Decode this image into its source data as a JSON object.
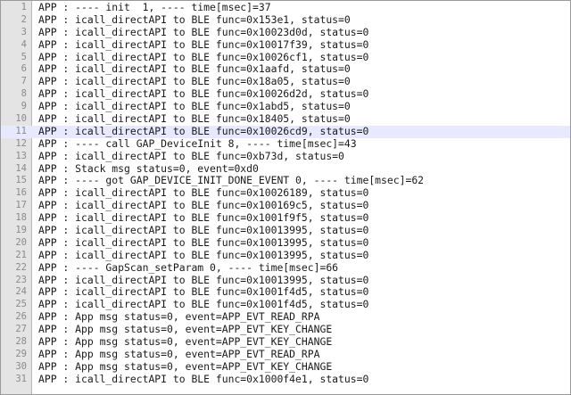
{
  "editor": {
    "active_line": 11,
    "lines": [
      {
        "number": "1",
        "text": "APP : ---- init  1, ---- time[msec]=37"
      },
      {
        "number": "2",
        "text": "APP : icall_directAPI to BLE func=0x153e1, status=0"
      },
      {
        "number": "3",
        "text": "APP : icall_directAPI to BLE func=0x10023d0d, status=0"
      },
      {
        "number": "4",
        "text": "APP : icall_directAPI to BLE func=0x10017f39, status=0"
      },
      {
        "number": "5",
        "text": "APP : icall_directAPI to BLE func=0x10026cf1, status=0"
      },
      {
        "number": "6",
        "text": "APP : icall_directAPI to BLE func=0x1aafd, status=0"
      },
      {
        "number": "7",
        "text": "APP : icall_directAPI to BLE func=0x18a05, status=0"
      },
      {
        "number": "8",
        "text": "APP : icall_directAPI to BLE func=0x10026d2d, status=0"
      },
      {
        "number": "9",
        "text": "APP : icall_directAPI to BLE func=0x1abd5, status=0"
      },
      {
        "number": "10",
        "text": "APP : icall_directAPI to BLE func=0x18405, status=0"
      },
      {
        "number": "11",
        "text": "APP : icall_directAPI to BLE func=0x10026cd9, status=0"
      },
      {
        "number": "12",
        "text": "APP : ---- call GAP_DeviceInit 8, ---- time[msec]=43"
      },
      {
        "number": "13",
        "text": "APP : icall_directAPI to BLE func=0xb73d, status=0"
      },
      {
        "number": "14",
        "text": "APP : Stack msg status=0, event=0xd0"
      },
      {
        "number": "15",
        "text": "APP : ---- got GAP_DEVICE_INIT_DONE_EVENT 0, ---- time[msec]=62"
      },
      {
        "number": "16",
        "text": "APP : icall_directAPI to BLE func=0x10026189, status=0"
      },
      {
        "number": "17",
        "text": "APP : icall_directAPI to BLE func=0x100169c5, status=0"
      },
      {
        "number": "18",
        "text": "APP : icall_directAPI to BLE func=0x1001f9f5, status=0"
      },
      {
        "number": "19",
        "text": "APP : icall_directAPI to BLE func=0x10013995, status=0"
      },
      {
        "number": "20",
        "text": "APP : icall_directAPI to BLE func=0x10013995, status=0"
      },
      {
        "number": "21",
        "text": "APP : icall_directAPI to BLE func=0x10013995, status=0"
      },
      {
        "number": "22",
        "text": "APP : ---- GapScan_setParam 0, ---- time[msec]=66"
      },
      {
        "number": "23",
        "text": "APP : icall_directAPI to BLE func=0x10013995, status=0"
      },
      {
        "number": "24",
        "text": "APP : icall_directAPI to BLE func=0x1001f4d5, status=0"
      },
      {
        "number": "25",
        "text": "APP : icall_directAPI to BLE func=0x1001f4d5, status=0"
      },
      {
        "number": "26",
        "text": "APP : App msg status=0, event=APP_EVT_READ_RPA"
      },
      {
        "number": "27",
        "text": "APP : App msg status=0, event=APP_EVT_KEY_CHANGE"
      },
      {
        "number": "28",
        "text": "APP : App msg status=0, event=APP_EVT_KEY_CHANGE"
      },
      {
        "number": "29",
        "text": "APP : App msg status=0, event=APP_EVT_READ_RPA"
      },
      {
        "number": "30",
        "text": "APP : App msg status=0, event=APP_EVT_KEY_CHANGE"
      },
      {
        "number": "31",
        "text": "APP : icall_directAPI to BLE func=0x1000f4e1, status=0"
      }
    ]
  }
}
